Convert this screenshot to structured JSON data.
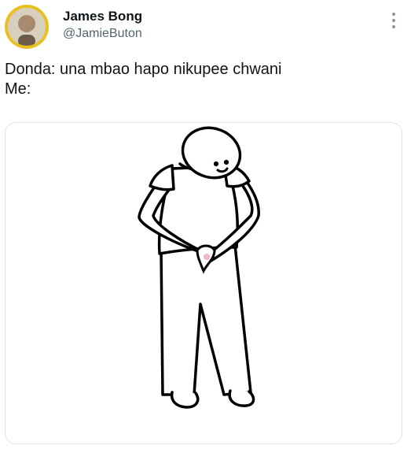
{
  "tweet": {
    "author": {
      "display_name": "James Bong",
      "handle": "@JamieButon",
      "avatar_icon": "user-avatar",
      "avatar_ring_color": "#e8c020"
    },
    "more_icon": "more-vertical-icon",
    "text_lines": [
      "Donda: una mbao hapo nikupee chwani",
      "Me:"
    ],
    "media": {
      "type": "image",
      "description_icon": "stick-figure-drawing"
    }
  },
  "colors": {
    "text_primary": "#0f1419",
    "text_secondary": "#536471",
    "icon_muted": "#8b98a5",
    "border": "#dfe3e7"
  }
}
